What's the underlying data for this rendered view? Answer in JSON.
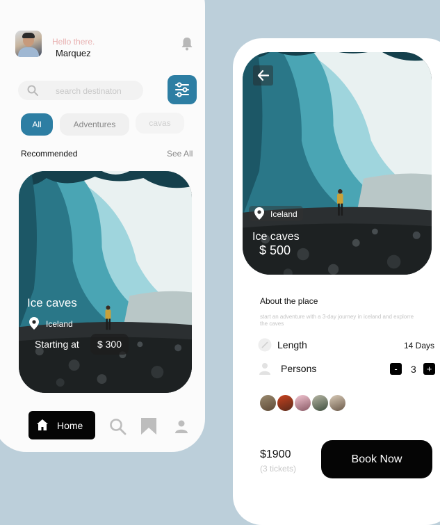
{
  "home": {
    "greeting": "Hello there.",
    "username": "Marquez",
    "search": {
      "placeholder": "search destinaton"
    },
    "categories": [
      "All",
      "Adventures",
      "cavas"
    ],
    "section_title": "Recommended",
    "see_all": "See All",
    "card": {
      "title": "Ice caves",
      "location": "Iceland",
      "starting_label": "Starting at",
      "price": "$ 300"
    },
    "nav": {
      "home_label": "Home"
    }
  },
  "detail": {
    "location": "Iceland",
    "title": "Ice caves",
    "price": "$ 500",
    "about_title": "About the place",
    "about_text": "start an adventure with a 3-day journey in iceland and explorre the caves",
    "length_label": "Length",
    "length_value": "14 Days",
    "persons_label": "Persons",
    "minus": "-",
    "persons_count": "3",
    "plus": "+",
    "total": "$1900",
    "tickets": "(3 tickets)",
    "book_label": "Book Now"
  },
  "colors": {
    "accent": "#2d7ea3",
    "background": "#bccfda",
    "dark": "#050505"
  },
  "icons": [
    "bell-icon",
    "search-icon",
    "filter-icon",
    "location-pin-icon",
    "home-icon",
    "bookmark-icon",
    "profile-icon",
    "back-arrow-icon",
    "length-icon",
    "person-icon"
  ]
}
